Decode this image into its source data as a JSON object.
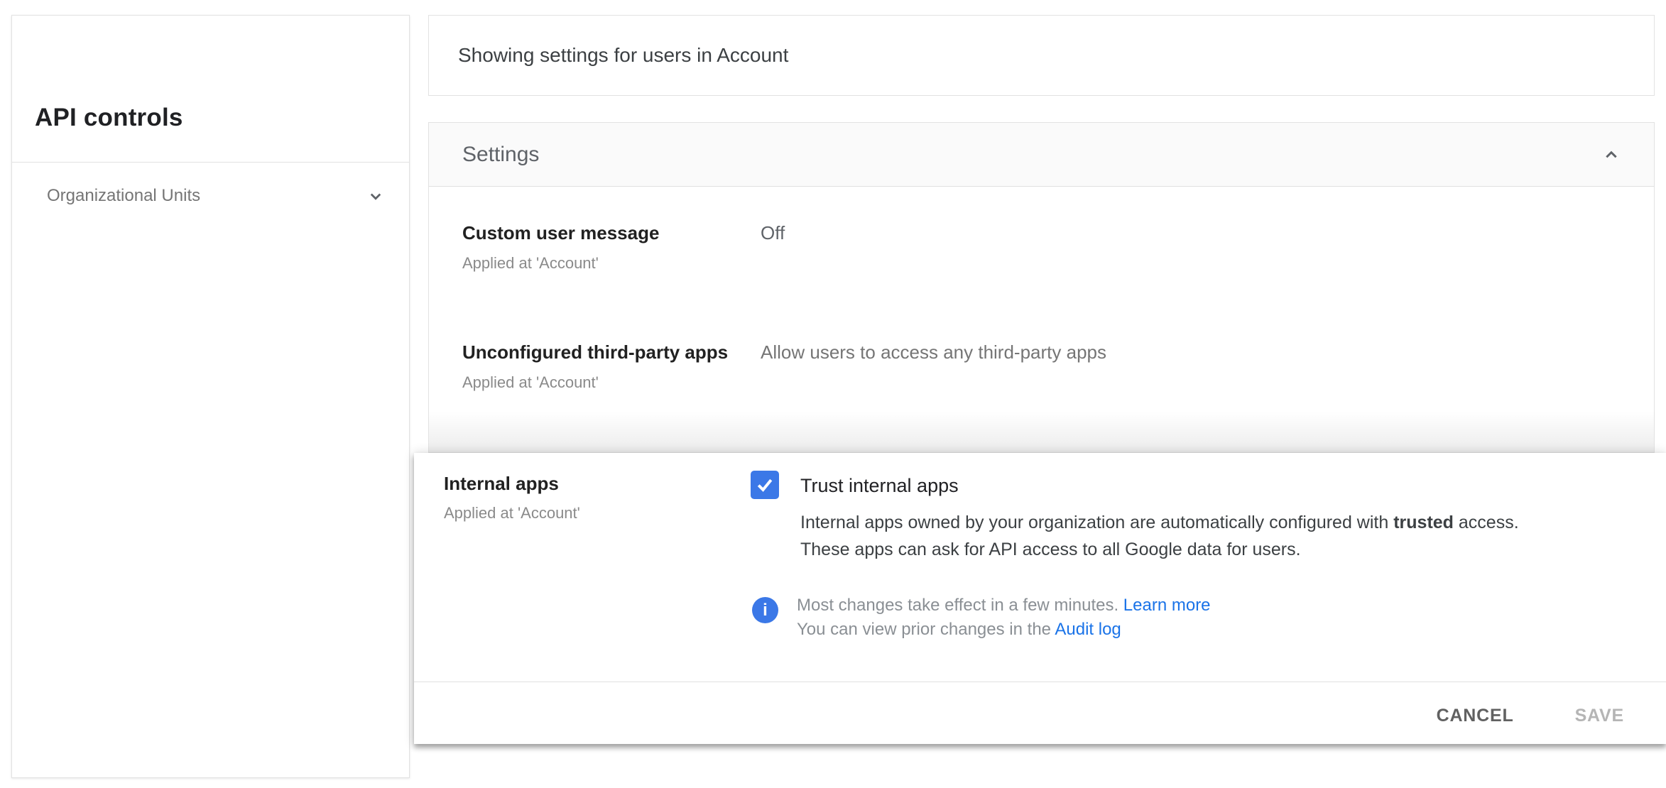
{
  "sidebar": {
    "title": "API controls",
    "items": [
      {
        "label": "Organizational Units",
        "icon": "chevron-down-icon",
        "expanded": false
      }
    ]
  },
  "topbar": {
    "scope_text": "Showing settings for users in Account"
  },
  "settings_card": {
    "title": "Settings",
    "collapse_icon": "chevron-up-icon",
    "rows": [
      {
        "name": "Custom user message",
        "applied_at": "Applied at 'Account'",
        "value": "Off"
      },
      {
        "name": "Unconfigured third-party apps",
        "applied_at": "Applied at 'Account'",
        "value": "Allow users to access any third-party apps"
      }
    ]
  },
  "edit_panel": {
    "name": "Internal apps",
    "applied_at": "Applied at 'Account'",
    "checkbox": {
      "checked": true,
      "label": "Trust internal apps"
    },
    "description": {
      "part1": "Internal apps owned by your organization are automatically configured with ",
      "bold": "trusted",
      "part2": " access.",
      "line2": "These apps can ask for API access to all Google data for users."
    },
    "note": {
      "line1_text": "Most changes take effect in a few minutes. ",
      "line1_link": "Learn more",
      "line2_text": "You can view prior changes in the ",
      "line2_link": "Audit log",
      "icon": "info-icon"
    },
    "actions": {
      "cancel_label": "CANCEL",
      "save_label": "SAVE",
      "save_disabled": true
    }
  },
  "colors": {
    "checkbox_blue": "#3b78e7",
    "info_blue": "#3b78e7",
    "link_blue": "#1a73e8",
    "header_bg": "#fafafa",
    "border": "#e2e2e2",
    "text_dark": "#212121",
    "text_gray": "#757575"
  }
}
